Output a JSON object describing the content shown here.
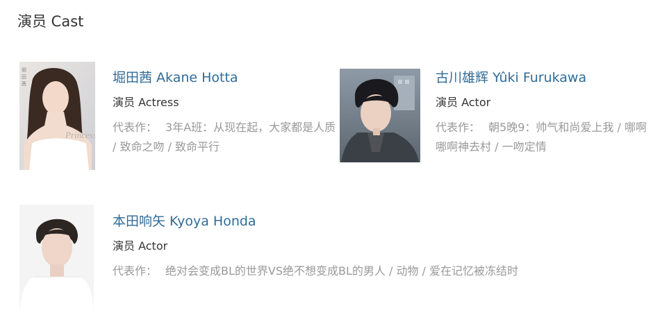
{
  "section": {
    "title": "演员 Cast"
  },
  "cast": [
    {
      "name": "堀田茜 Akane Hotta",
      "role": "演员 Actress",
      "works_label": "代表作：",
      "works": "3年A班：从现在起，大家都是人质 / 致命之吻 / 致命平行"
    },
    {
      "name": "古川雄辉 Yûki Furukawa",
      "role": "演员 Actor",
      "works_label": "代表作：",
      "works": "朝5晚9：帅气和尚爱上我 / 哪啊哪啊神去村 / 一吻定情"
    },
    {
      "name": "本田响矢 Kyoya Honda",
      "role": "演员 Actor",
      "works_label": "代表作：",
      "works": "绝对会变成BL的世界VS绝不想变成BL的男人 / 动物 / 爱在记忆被冻结时"
    }
  ],
  "colors": {
    "name_link": "#2f6c98",
    "role_text": "#333333",
    "works_text": "#999999",
    "title_text": "#333333"
  },
  "icons": {
    "photo_1": "actress-photo",
    "photo_2": "actor-photo",
    "photo_3": "actor-photo"
  }
}
